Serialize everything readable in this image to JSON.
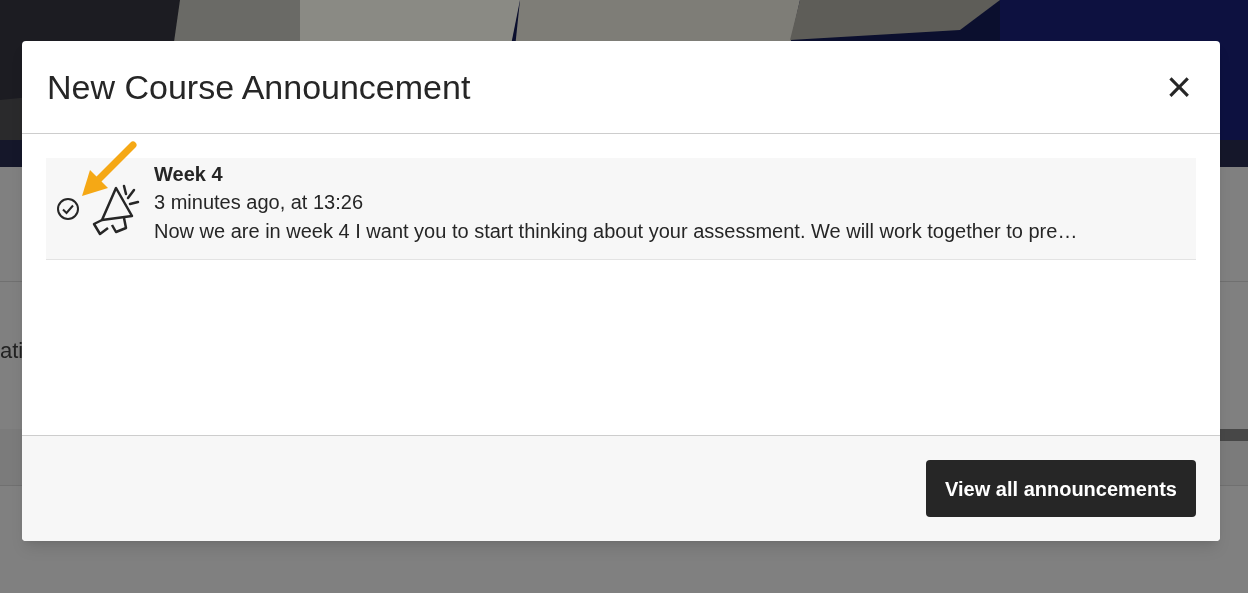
{
  "background_page": {
    "partial_text": "ati"
  },
  "dialog": {
    "title": "New Course Announcement",
    "close_label": "×",
    "announcements": [
      {
        "title": "Week 4",
        "time": "3 minutes ago, at 13:26",
        "preview": "Now we are in week 4 I want you to start thinking about your assessment. We will work together to pre…",
        "read": true
      }
    ],
    "footer_button": "View all announcements"
  }
}
